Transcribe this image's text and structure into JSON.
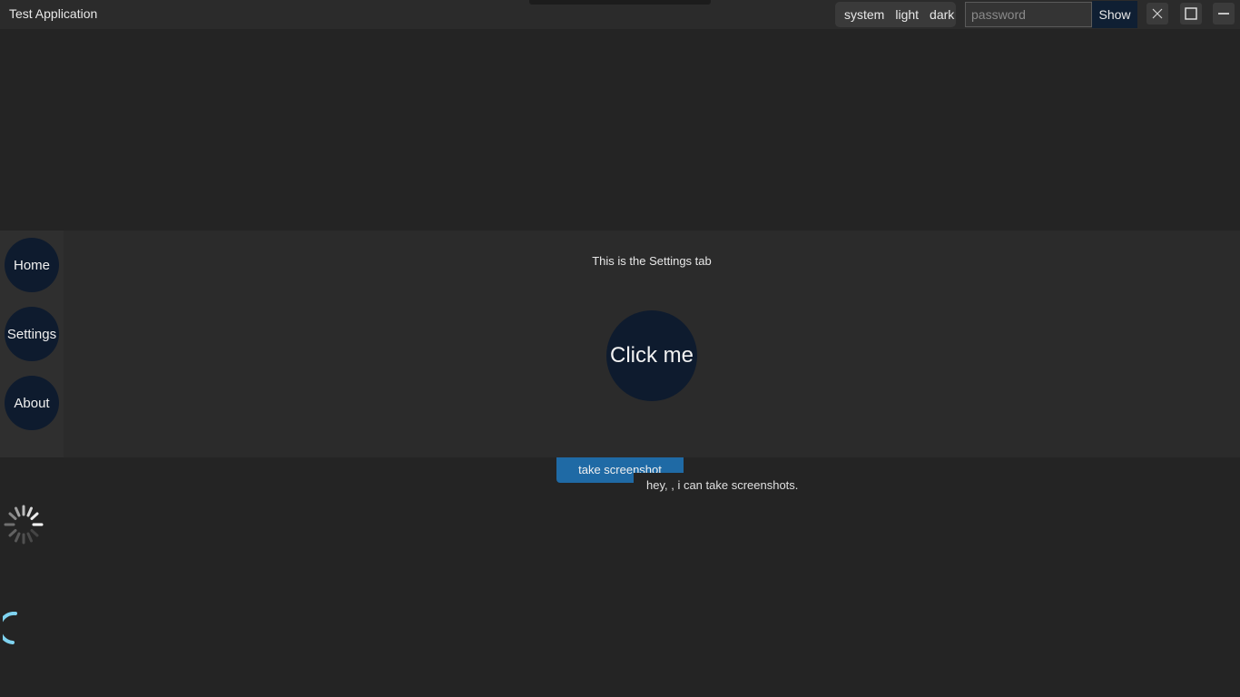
{
  "app": {
    "title": "Test Application"
  },
  "theme": {
    "options": [
      "system",
      "light",
      "dark"
    ]
  },
  "password": {
    "placeholder": "password",
    "value": "",
    "show_label": "Show"
  },
  "window_controls": {
    "icons": [
      "close-icon",
      "maximize-icon",
      "minimize-icon"
    ]
  },
  "sidebar": {
    "items": [
      {
        "label": "Home"
      },
      {
        "label": "Settings"
      },
      {
        "label": "About"
      }
    ]
  },
  "main": {
    "tab_text": "This is the Settings tab",
    "click_label": "Click me"
  },
  "screenshot": {
    "button_label": "take screenshot",
    "tooltip": "hey, , i can take screenshots."
  },
  "colors": {
    "accent": "#1f6aa5",
    "nav_button": "#0e1b2e",
    "arc": "#7fd3f0"
  }
}
